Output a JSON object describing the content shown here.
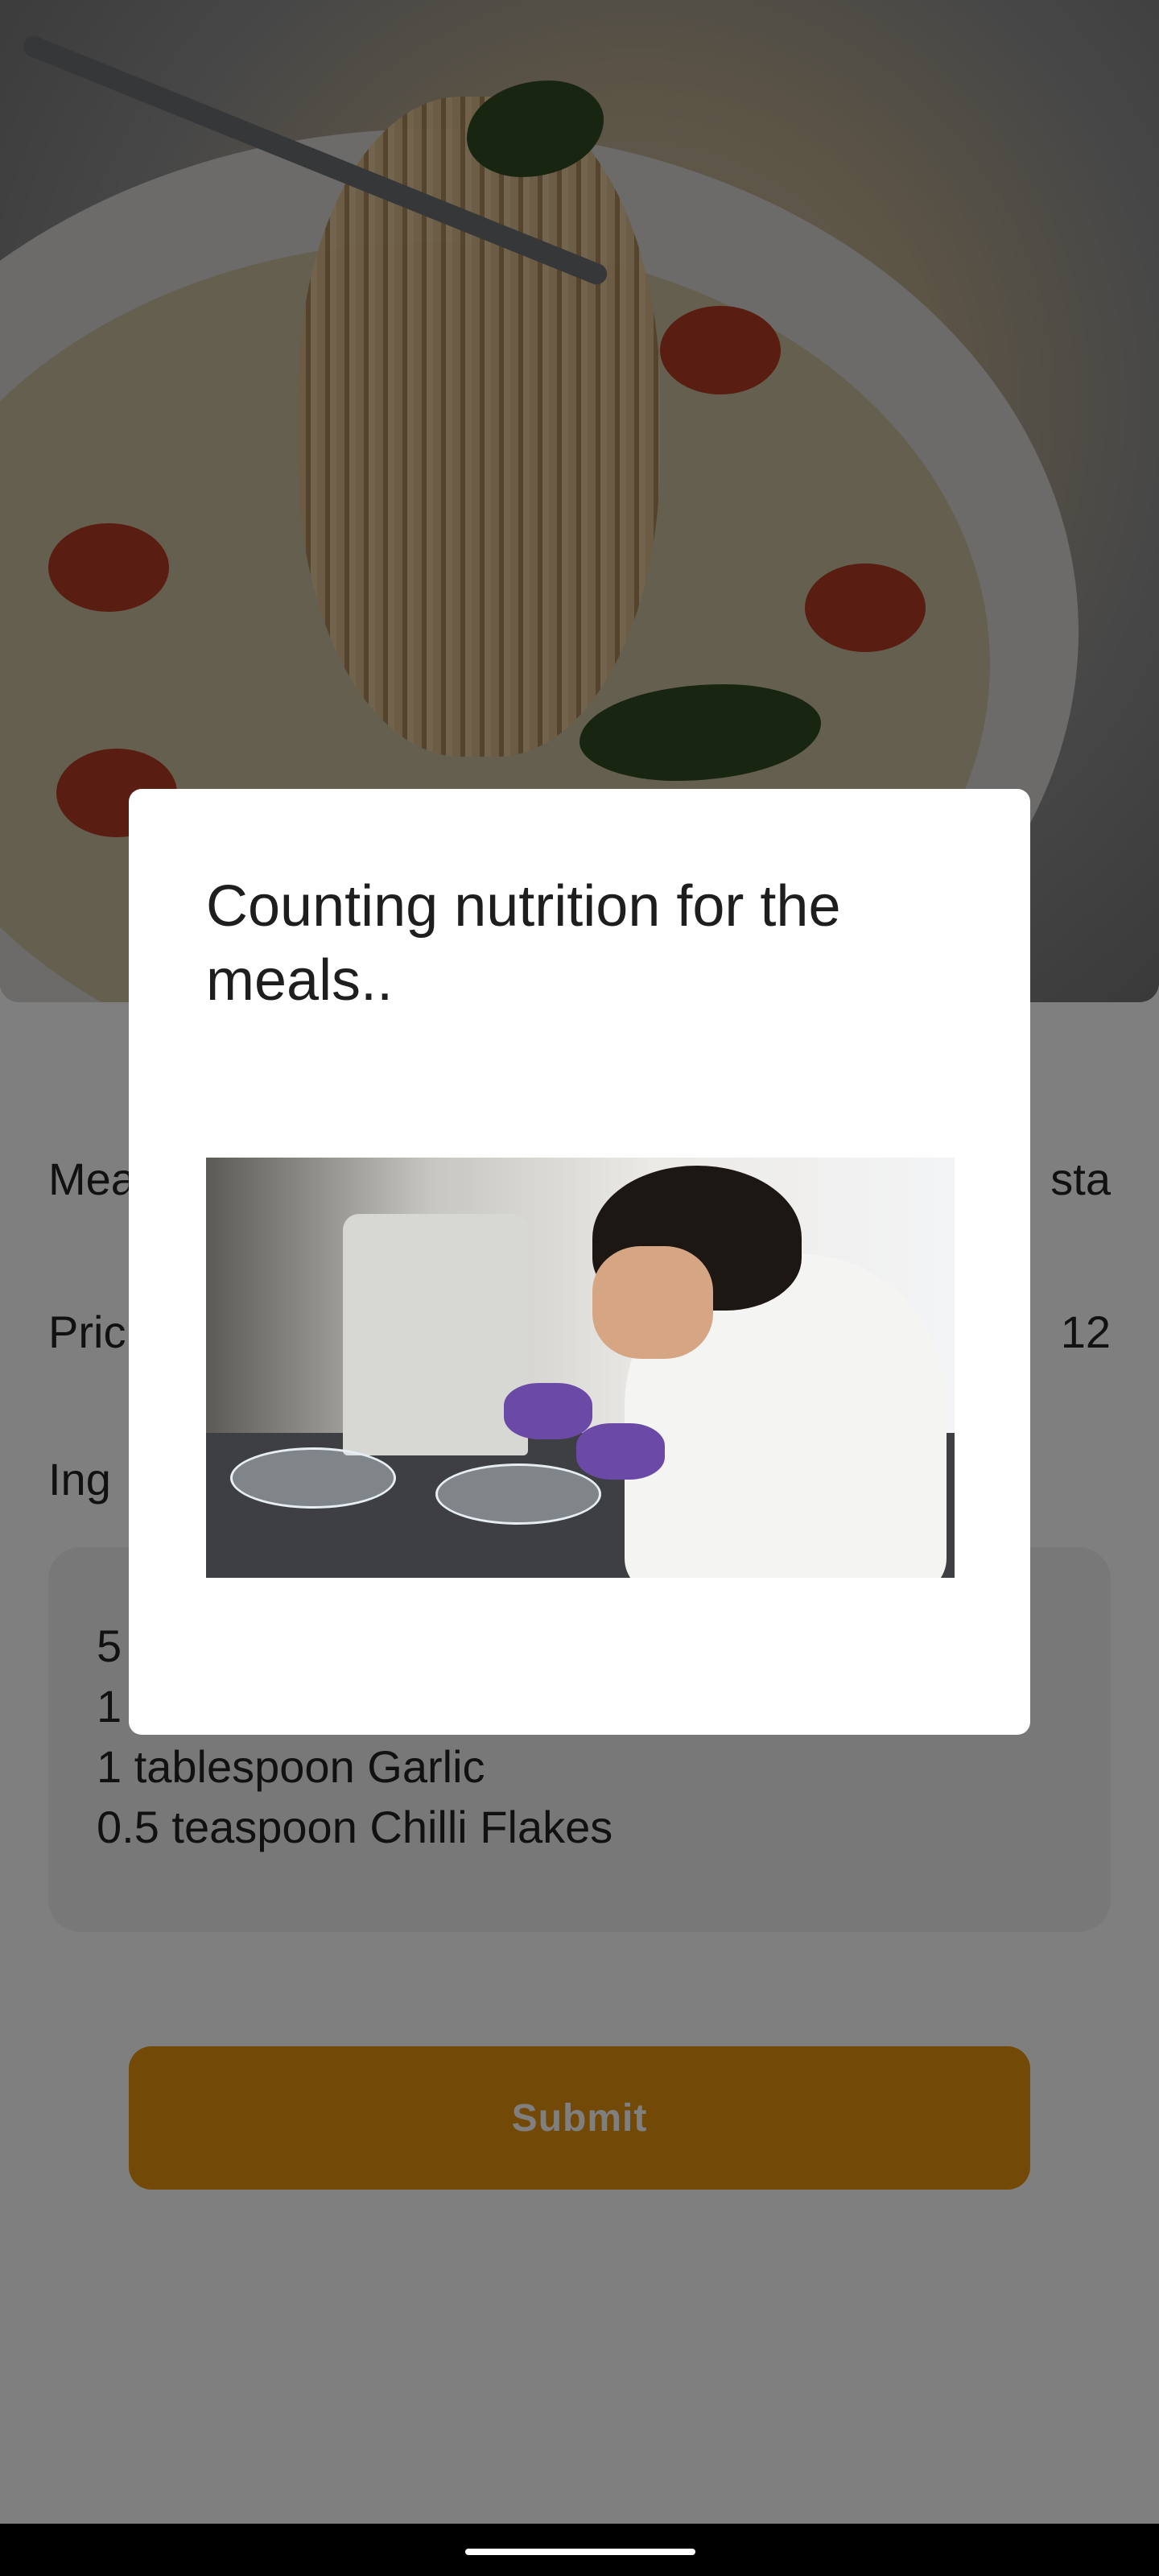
{
  "hero_image": {
    "alt_icon": "pasta-photo"
  },
  "form": {
    "meal_label_fragment": "Mea",
    "meal_value_fragment": "sta",
    "price_label_fragment": "Pric",
    "price_value_fragment": "12",
    "ingredients_label_fragment": "Ing",
    "ingredient_lines": [
      "5",
      "1",
      "1 tablespoon Garlic",
      "0.5 teaspoon Chilli Flakes"
    ],
    "submit_label": "Submit"
  },
  "dialog": {
    "title": "Counting nutrition for the meals..",
    "image_icon": "lab-scientist-photo"
  },
  "colors": {
    "accent": "#e5930f",
    "scrim": "rgba(0,0,0,0.5)",
    "dialog_bg": "#ffffff"
  }
}
